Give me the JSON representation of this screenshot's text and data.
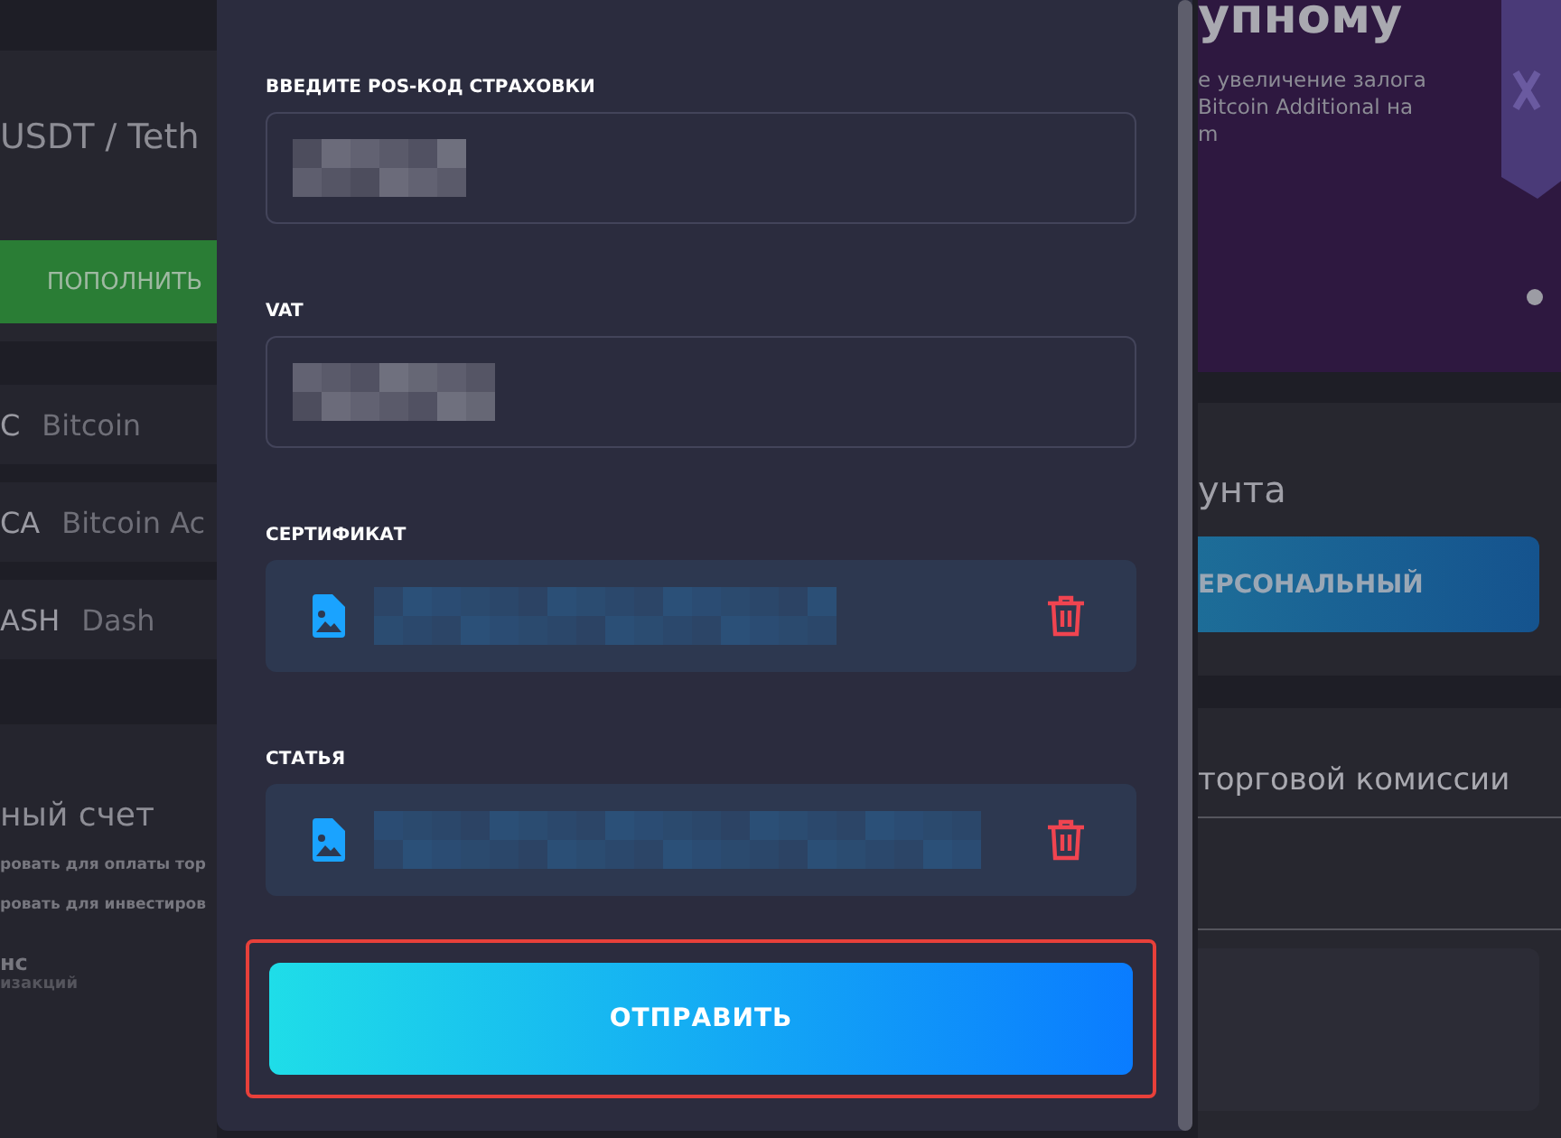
{
  "background_left": {
    "pair_title": "USDT / Teth",
    "deposit_button": "ПОПОЛНИТЬ",
    "coins": [
      {
        "ticker": "C",
        "name": "Bitcoin"
      },
      {
        "ticker": "CA",
        "name": "Bitcoin Ac"
      },
      {
        "ticker": "ASH",
        "name": "Dash"
      }
    ],
    "account_title": "ный счет",
    "account_lines": [
      "ровать для оплаты тор",
      "ровать для инвестиров"
    ],
    "balance_title": "нс",
    "balance_caption": "изакций"
  },
  "background_right": {
    "banner": {
      "title": "упному",
      "lines": [
        "е увеличение залога",
        "Bitcoin Additional на",
        "m"
      ],
      "dots": [
        {
          "selected": true
        }
      ]
    },
    "account_title": "унта",
    "personal_button": "ЕРСОНАЛЬНЫЙ",
    "commission_title": "торговой комиссии"
  },
  "form": {
    "fields": [
      {
        "kind": "text",
        "label": "ВВЕДИТЕ POS-КОД СТРАХОВКИ"
      },
      {
        "kind": "text",
        "label": "VAT"
      },
      {
        "kind": "file",
        "label": "СЕРТИФИКАТ"
      },
      {
        "kind": "file",
        "label": "СТАТЬЯ"
      }
    ],
    "submit": {
      "label": "ОТПРАВИТЬ",
      "highlighted": true
    }
  }
}
